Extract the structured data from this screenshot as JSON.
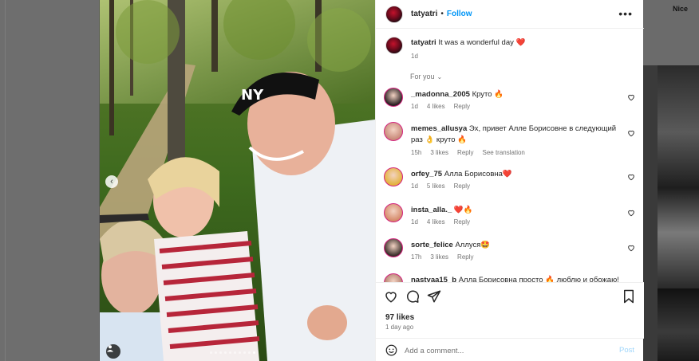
{
  "corner_label": "Nice",
  "post": {
    "username": "tatyatri",
    "separator": "•",
    "follow_label": "Follow",
    "more_icon": "more-horizontal-icon",
    "caption_text": "It was a wonderful day",
    "caption_emoji": "❤️",
    "caption_time": "1d",
    "carousel": {
      "slides": 10,
      "active_index": 9
    }
  },
  "section": {
    "label": "For you",
    "chevron": "⌄"
  },
  "comments": [
    {
      "user": "_madonna_2005",
      "text": "Круто 🔥",
      "time": "1d",
      "likes": "4 likes",
      "reply": "Reply",
      "extra": "",
      "avatar_color": "#2a2022"
    },
    {
      "user": "memes_allusya",
      "text": "Эх, привет Алле Борисовне в следующий раз 👌 круто 🔥",
      "time": "15h",
      "likes": "3 likes",
      "reply": "Reply",
      "extra": "See translation",
      "avatar_color": "#c98a7a"
    },
    {
      "user": "orfey_75",
      "text": "Алла Борисовна❤️",
      "time": "1d",
      "likes": "5 likes",
      "reply": "Reply",
      "extra": "",
      "avatar_color": "#e3b23c"
    },
    {
      "user": "insta_alla._",
      "text": "❤️🔥",
      "time": "1d",
      "likes": "4 likes",
      "reply": "Reply",
      "extra": "",
      "avatar_color": "#d58a6a"
    },
    {
      "user": "sorte_felice",
      "text": "Аллуся🤩",
      "time": "17h",
      "likes": "3 likes",
      "reply": "Reply",
      "extra": "",
      "avatar_color": "#3a2e2a"
    },
    {
      "user": "nastyaa15_b",
      "text": "Алла Борисовна просто 🔥 люблю и обожаю!",
      "time": "",
      "likes": "",
      "reply": "",
      "extra": "",
      "avatar_color": "#b07a6a"
    }
  ],
  "actions": {
    "icons": [
      "heart-icon",
      "comment-icon",
      "share-icon",
      "bookmark-icon"
    ],
    "likes": "97 likes",
    "ago": "1 day ago"
  },
  "composer": {
    "placeholder": "Add a comment...",
    "post_label": "Post",
    "emoji_icon": "smiley-icon"
  },
  "colors": {
    "link": "#0095f6",
    "muted": "#737373",
    "post_disabled": "#9fd6fb",
    "story_ring": "#d3237e"
  }
}
